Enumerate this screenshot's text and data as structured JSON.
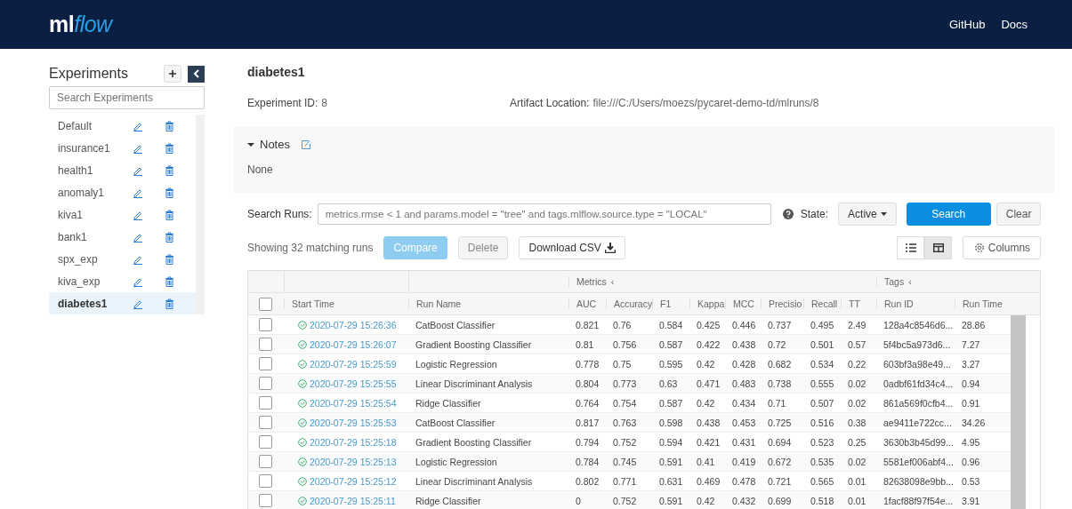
{
  "header": {
    "logo_prefix": "ml",
    "logo_suffix": "flow",
    "links": [
      "GitHub",
      "Docs"
    ]
  },
  "sidebar": {
    "title": "Experiments",
    "search": {
      "placeholder": "Search Experiments"
    },
    "items": [
      {
        "name": "Default",
        "selected": false
      },
      {
        "name": "insurance1",
        "selected": false
      },
      {
        "name": "health1",
        "selected": false
      },
      {
        "name": "anomaly1",
        "selected": false
      },
      {
        "name": "kiva1",
        "selected": false
      },
      {
        "name": "bank1",
        "selected": false
      },
      {
        "name": "spx_exp",
        "selected": false
      },
      {
        "name": "kiva_exp",
        "selected": false
      },
      {
        "name": "diabetes1",
        "selected": true
      }
    ]
  },
  "experiment": {
    "title": "diabetes1",
    "id_label": "Experiment ID:",
    "id_value": "8",
    "artifact_label": "Artifact Location:",
    "artifact_value": "file:///C:/Users/moezs/pycaret-demo-td/mlruns/8",
    "notes": {
      "title": "Notes",
      "expanded": true,
      "text": "None"
    }
  },
  "search": {
    "label": "Search Runs:",
    "placeholder": "metrics.rmse < 1 and params.model = \"tree\" and tags.mlflow.source.type = \"LOCAL\"",
    "state_label": "State:",
    "state_value": "Active",
    "search_button": "Search",
    "clear_button": "Clear"
  },
  "toolbar": {
    "count": "Showing 32 matching runs",
    "compare": "Compare",
    "delete": "Delete",
    "download": "Download CSV",
    "views": [
      {
        "kind": "list",
        "selected": false
      },
      {
        "kind": "grid",
        "selected": true
      }
    ],
    "columns": "Columns"
  },
  "table": {
    "select_all_checked": false,
    "groups": [
      {
        "title": "Metrics",
        "collapse": "‹"
      },
      {
        "title": "Tags",
        "collapse": "‹"
      }
    ],
    "columns": [
      "Start Time",
      "Run Name",
      "AUC",
      "Accuracy",
      "F1",
      "Kappa",
      "MCC",
      "Precisio",
      "Recall",
      "TT",
      "Run ID",
      "Run Time"
    ],
    "rows": [
      {
        "checked": false,
        "cells": [
          "2020-07-29 15:26:36",
          "CatBoost Classifier",
          "0.821",
          "0.76",
          "0.584",
          "0.425",
          "0.446",
          "0.737",
          "0.495",
          "2.49",
          "128a4c8546d6...",
          "28.86"
        ]
      },
      {
        "checked": false,
        "cells": [
          "2020-07-29 15:26:07",
          "Gradient Boosting Classifier",
          "0.81",
          "0.756",
          "0.587",
          "0.422",
          "0.438",
          "0.72",
          "0.501",
          "0.57",
          "5f4bc5a973d6...",
          "7.27"
        ]
      },
      {
        "checked": false,
        "cells": [
          "2020-07-29 15:25:59",
          "Logistic Regression",
          "0.778",
          "0.75",
          "0.595",
          "0.42",
          "0.428",
          "0.682",
          "0.534",
          "0.22",
          "603bf3a98e49...",
          "3.27"
        ]
      },
      {
        "checked": false,
        "cells": [
          "2020-07-29 15:25:55",
          "Linear Discriminant Analysis",
          "0.804",
          "0.773",
          "0.63",
          "0.471",
          "0.483",
          "0.738",
          "0.555",
          "0.02",
          "0adbf61fd34c4...",
          "0.94"
        ]
      },
      {
        "checked": false,
        "cells": [
          "2020-07-29 15:25:54",
          "Ridge Classifier",
          "0.764",
          "0.754",
          "0.587",
          "0.42",
          "0.434",
          "0.71",
          "0.507",
          "0.02",
          "861a569f0cfb4...",
          "0.91"
        ]
      },
      {
        "checked": false,
        "cells": [
          "2020-07-29 15:25:53",
          "CatBoost Classifier",
          "0.817",
          "0.763",
          "0.598",
          "0.438",
          "0.453",
          "0.725",
          "0.516",
          "0.38",
          "ae9411e722cc...",
          "34.26"
        ]
      },
      {
        "checked": false,
        "cells": [
          "2020-07-29 15:25:18",
          "Gradient Boosting Classifier",
          "0.794",
          "0.752",
          "0.594",
          "0.421",
          "0.431",
          "0.694",
          "0.523",
          "0.25",
          "3630b3b45d99...",
          "4.95"
        ]
      },
      {
        "checked": false,
        "cells": [
          "2020-07-29 15:25:13",
          "Logistic Regression",
          "0.784",
          "0.745",
          "0.591",
          "0.41",
          "0.419",
          "0.672",
          "0.535",
          "0.02",
          "5581ef006abf4...",
          "0.96"
        ]
      },
      {
        "checked": false,
        "cells": [
          "2020-07-29 15:25:12",
          "Linear Discriminant Analysis",
          "0.802",
          "0.771",
          "0.631",
          "0.469",
          "0.478",
          "0.721",
          "0.565",
          "0.01",
          "82638098e9bb...",
          "0.53"
        ]
      },
      {
        "checked": false,
        "cells": [
          "2020-07-29 15:25:11",
          "Ridge Classifier",
          "0",
          "0.752",
          "0.591",
          "0.42",
          "0.432",
          "0.699",
          "0.518",
          "0.01",
          "1facf88f97f54e...",
          "3.91"
        ]
      }
    ]
  }
}
